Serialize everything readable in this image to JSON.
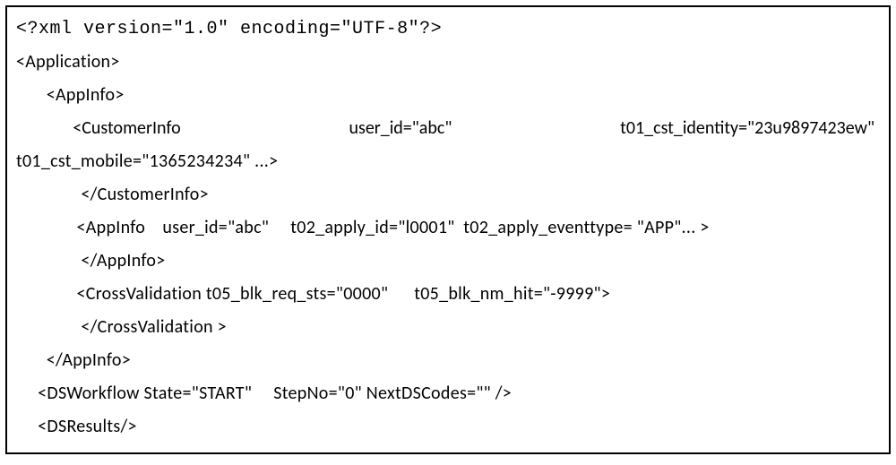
{
  "lines": {
    "l1": "<?xml version=\"1.0\" encoding=\"UTF-8\"?>",
    "l2": "<Application>",
    "l3": "       <AppInfo>",
    "l4a": "              <CustomerInfo",
    "l4b": "user_id=\"abc\"",
    "l4c": "t01_cst_identity=\"23u9897423ew\"",
    "l5": "t01_cst_mobile=\"1365234234\" ...>",
    "l6": "               </CustomerInfo>",
    "l7": "              <AppInfo    user_id=\"abc\"     t02_apply_id=\"l0001\"  t02_apply_eventtype= \"APP\"... >",
    "l8": "               </AppInfo>",
    "l9": "              <CrossValidation t05_blk_req_sts=\"0000\"      t05_blk_nm_hit=\"-9999\">",
    "l10": "               </CrossValidation >",
    "l11": "       </AppInfo>",
    "l12": "     <DSWorkflow State=\"START\"     StepNo=\"0\" NextDSCodes=\"\" />",
    "l13": "     <DSResults/>"
  }
}
